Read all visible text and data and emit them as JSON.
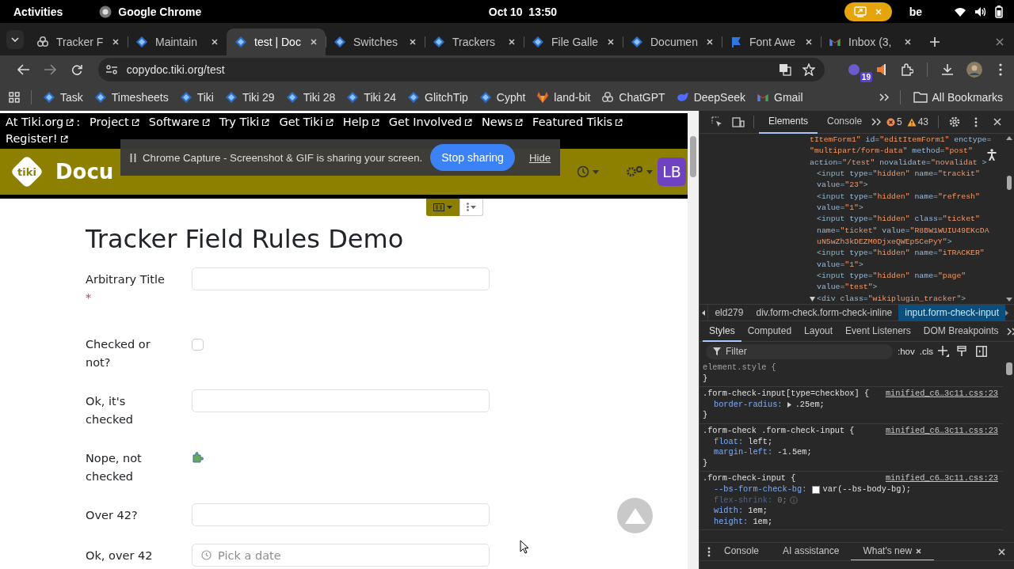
{
  "system_bar": {
    "activities": "Activities",
    "app": "Google Chrome",
    "date": "Oct 10",
    "time": "13:50",
    "keyboard": "be",
    "screen_sharing": true
  },
  "tabs": [
    {
      "title": "Tracker F",
      "kind": "knot",
      "selected": false
    },
    {
      "title": "Maintain",
      "kind": "diamond",
      "selected": false
    },
    {
      "title": "test | Doc",
      "kind": "diamond",
      "selected": true
    },
    {
      "title": "Switches",
      "kind": "diamond",
      "selected": false
    },
    {
      "title": "Trackers",
      "kind": "diamond",
      "selected": false
    },
    {
      "title": "File Galle",
      "kind": "diamond",
      "selected": false
    },
    {
      "title": "Documen",
      "kind": "diamond",
      "selected": false
    },
    {
      "title": "Font Awe",
      "kind": "flag",
      "selected": false
    },
    {
      "title": "Inbox (3,",
      "kind": "envelope",
      "selected": false
    }
  ],
  "address_bar": {
    "url": "copydoc.tiki.org/test",
    "extension_badge": "19"
  },
  "bookmarks": [
    {
      "label": "Task",
      "kind": "diamond"
    },
    {
      "label": "Timesheets",
      "kind": "diamond"
    },
    {
      "label": "Tiki",
      "kind": "diamond"
    },
    {
      "label": "Tiki 29",
      "kind": "diamond"
    },
    {
      "label": "Tiki 28",
      "kind": "diamond"
    },
    {
      "label": "Tiki 24",
      "kind": "diamond"
    },
    {
      "label": "GlitchTip",
      "kind": "diamond"
    },
    {
      "label": "Cypht",
      "kind": "diamond"
    },
    {
      "label": "land-bit",
      "kind": "fox"
    },
    {
      "label": "ChatGPT",
      "kind": "knot"
    },
    {
      "label": "DeepSeek",
      "kind": "whale"
    },
    {
      "label": "Gmail",
      "kind": "envelope"
    }
  ],
  "all_bookmarks": "All Bookmarks",
  "site_nav": [
    {
      "label": "At Tiki.org",
      "suffix": ":"
    },
    {
      "label": "Project"
    },
    {
      "label": "Software"
    },
    {
      "label": "Try Tiki"
    },
    {
      "label": "Get Tiki"
    },
    {
      "label": "Help"
    },
    {
      "label": "Get Involved"
    },
    {
      "label": "News"
    },
    {
      "label": "Featured Tikis"
    },
    {
      "label": "Register!"
    }
  ],
  "site_header": {
    "logo": "tiki",
    "title": "Docu",
    "avatar": "LB"
  },
  "capture_banner": {
    "message": "Chrome Capture - Screenshot & GIF is sharing your screen.",
    "stop": "Stop sharing",
    "hide": "Hide"
  },
  "page": {
    "title": "Tracker Field Rules Demo",
    "fields": [
      {
        "label": "Arbitrary Title",
        "required_mark": "*",
        "kind": "text"
      },
      {
        "label": "Checked or not?",
        "kind": "checkbox",
        "checked": false
      },
      {
        "label": "Ok, it's checked",
        "kind": "text"
      },
      {
        "label": "Nope, not checked",
        "kind": "icon"
      },
      {
        "label": "Over 42?",
        "kind": "text"
      },
      {
        "label": "Ok, over 42",
        "kind": "date",
        "placeholder": "Pick a date"
      }
    ]
  },
  "devtools": {
    "tabs": [
      {
        "label": "Elements",
        "selected": true
      },
      {
        "label": "Console",
        "selected": false
      }
    ],
    "errors": "5",
    "warnings": "43",
    "dom": {
      "lines": [
        [
          {
            "kind": "value",
            "text": "tItemForm1\""
          },
          {
            "kind": "attribute",
            "text": " id="
          },
          {
            "kind": "value",
            "text": "\"editItemForm1\""
          },
          {
            "kind": "attribute",
            "text": " enctype="
          }
        ],
        [
          {
            "kind": "value",
            "text": "\"multipart/form-data\""
          },
          {
            "kind": "attribute",
            "text": " method="
          },
          {
            "kind": "value",
            "text": "\"post\""
          }
        ],
        [
          {
            "kind": "attribute",
            "text": "action="
          },
          {
            "kind": "value",
            "text": "\"/test\""
          },
          {
            "kind": "attribute",
            "text": " novalidate="
          },
          {
            "kind": "value",
            "text": "\"novalidat"
          },
          {
            "kind": "tag",
            "text": " >"
          }
        ]
      ],
      "children": [
        {
          "lines": [
            [
              {
                "kind": "tag",
                "text": "<input"
              },
              {
                "kind": "attribute",
                "text": " type="
              },
              {
                "kind": "value",
                "text": "\"hidden\""
              },
              {
                "kind": "attribute",
                "text": " name="
              },
              {
                "kind": "value",
                "text": "\"trackit\""
              }
            ],
            [
              {
                "kind": "attribute",
                "text": "value="
              },
              {
                "kind": "value",
                "text": "\"23\""
              },
              {
                "kind": "tag",
                "text": ">"
              }
            ]
          ]
        },
        {
          "lines": [
            [
              {
                "kind": "tag",
                "text": "<input"
              },
              {
                "kind": "attribute",
                "text": " type="
              },
              {
                "kind": "value",
                "text": "\"hidden\""
              },
              {
                "kind": "attribute",
                "text": " name="
              },
              {
                "kind": "value",
                "text": "\"refresh\""
              }
            ],
            [
              {
                "kind": "attribute",
                "text": "value="
              },
              {
                "kind": "value",
                "text": "\"1\""
              },
              {
                "kind": "tag",
                "text": ">"
              }
            ]
          ]
        },
        {
          "lines": [
            [
              {
                "kind": "tag",
                "text": "<input"
              },
              {
                "kind": "attribute",
                "text": " type="
              },
              {
                "kind": "value",
                "text": "\"hidden\""
              },
              {
                "kind": "attribute",
                "text": " class="
              },
              {
                "kind": "value",
                "text": "\"ticket\""
              }
            ],
            [
              {
                "kind": "attribute",
                "text": "name="
              },
              {
                "kind": "value",
                "text": "\"ticket\""
              },
              {
                "kind": "attribute",
                "text": " value="
              },
              {
                "kind": "value",
                "text": "\"R8BW1WUIU49EKcDA"
              }
            ],
            [
              {
                "kind": "value",
                "text": "uN5wZh3kDEZM0DjxeQWEp5CePyY\""
              },
              {
                "kind": "tag",
                "text": ">"
              }
            ]
          ]
        },
        {
          "lines": [
            [
              {
                "kind": "tag",
                "text": "<input"
              },
              {
                "kind": "attribute",
                "text": " type="
              },
              {
                "kind": "value",
                "text": "\"hidden\""
              },
              {
                "kind": "attribute",
                "text": " name="
              },
              {
                "kind": "value",
                "text": "\"iTRACKER\""
              }
            ],
            [
              {
                "kind": "attribute",
                "text": "value="
              },
              {
                "kind": "value",
                "text": "\"1\""
              },
              {
                "kind": "tag",
                "text": ">"
              }
            ]
          ]
        },
        {
          "lines": [
            [
              {
                "kind": "tag",
                "text": "<input"
              },
              {
                "kind": "attribute",
                "text": " type="
              },
              {
                "kind": "value",
                "text": "\"hidden\""
              },
              {
                "kind": "attribute",
                "text": " name="
              },
              {
                "kind": "value",
                "text": "\"page\""
              }
            ],
            [
              {
                "kind": "attribute",
                "text": "value="
              },
              {
                "kind": "value",
                "text": "\"test\""
              },
              {
                "kind": "tag",
                "text": ">"
              }
            ]
          ]
        },
        {
          "expanded": true,
          "lines": [
            [
              {
                "kind": "tag",
                "text": "<div"
              },
              {
                "kind": "attribute",
                "text": " class="
              },
              {
                "kind": "value",
                "text": "\"wikiplugin_tracker\""
              },
              {
                "kind": "tag",
                "text": ">"
              }
            ]
          ]
        }
      ]
    },
    "breadcrumbs": [
      {
        "label": "eld279",
        "selected": false
      },
      {
        "label": "div.form-check.form-check-inline",
        "selected": false
      },
      {
        "label": "input.form-check-input",
        "selected": true
      }
    ],
    "pane_tabs": [
      {
        "label": "Styles",
        "selected": true
      },
      {
        "label": "Computed",
        "selected": false
      },
      {
        "label": "Layout",
        "selected": false
      },
      {
        "label": "Event Listeners",
        "selected": false
      },
      {
        "label": "DOM Breakpoints",
        "selected": false
      }
    ],
    "filter_placeholder": "Filter",
    "filter_buttons": [
      ":hov",
      ".cls"
    ],
    "rules": [
      {
        "selector": "element.style {",
        "close": "}"
      },
      {
        "selector": ".form-check-input[type=checkbox] {",
        "source": "minified_c6…3c11.css:23",
        "close": "}",
        "declarations": [
          {
            "property": "border-radius:",
            "value": ".25em;",
            "expandable": true,
            "swatch": false,
            "inactive": false
          }
        ]
      },
      {
        "selector": ".form-check .form-check-input {",
        "source": "minified_c6…3c11.css:23",
        "close": "}",
        "declarations": [
          {
            "property": "float:",
            "value": "left;",
            "expandable": false,
            "swatch": false,
            "inactive": false
          },
          {
            "property": "margin-left:",
            "value": "-1.5em;",
            "expandable": false,
            "swatch": false,
            "inactive": false
          }
        ]
      },
      {
        "selector": ".form-check-input {",
        "source": "minified_c6…3c11.css:23",
        "declarations": [
          {
            "property": "--bs-form-check-bg:",
            "value": "var(--bs-body-bg);",
            "expandable": false,
            "swatch": true,
            "inactive": false
          },
          {
            "property": "flex-shrink:",
            "value": "0;",
            "expandable": false,
            "swatch": false,
            "inactive": true
          },
          {
            "property": "width:",
            "value": "1em;",
            "expandable": false,
            "swatch": false,
            "inactive": false
          },
          {
            "property": "height:",
            "value": "1em;",
            "expandable": false,
            "swatch": false,
            "inactive": false
          }
        ]
      }
    ],
    "drawer_tabs": [
      {
        "label": "Console",
        "selected": false
      },
      {
        "label": "AI assistance",
        "selected": false
      },
      {
        "label": "What's new",
        "selected": true
      }
    ]
  }
}
